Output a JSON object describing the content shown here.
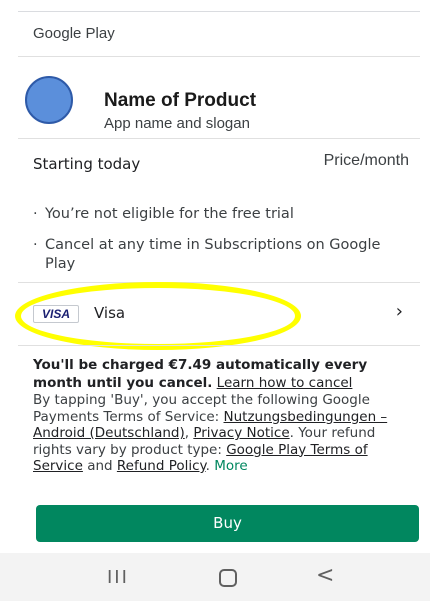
{
  "header": {
    "store_title": "Google Play"
  },
  "product": {
    "name": "Name of Product",
    "subtitle": "App name and slogan"
  },
  "pricing": {
    "start_label": "Starting today",
    "price_label": "Price/month"
  },
  "bullets": [
    "You’re not eligible for the free trial",
    "Cancel at any time in Subscriptions on Google Play"
  ],
  "payment": {
    "badge": "VISA",
    "method": "Visa",
    "chevron": "›"
  },
  "charge": {
    "bold_text": "You'll be charged €7.49 automatically every month until you cancel.",
    "link": "Learn how to cancel"
  },
  "terms": {
    "intro": "By tapping 'Buy', you accept the following Google Payments Terms of Service: ",
    "link1": "Nutzungsbedingungen – Android (Deutschland)",
    "sep1": ", ",
    "link2": "Privacy Notice",
    "mid": ". Your refund rights vary by product type: ",
    "link3": "Google Play Terms of Service",
    "and": " and ",
    "link4": "Refund Policy",
    "dot": ". ",
    "more": "More"
  },
  "buy_label": "Buy",
  "nav": {
    "recent_icon": "recent-apps-icon",
    "home_icon": "home-icon",
    "back_icon": "back-icon",
    "recent_glyph": "III",
    "back_glyph": "<"
  },
  "colors": {
    "accent": "#01875f",
    "highlight": "#ffff00",
    "avatar": "#5b8fdb"
  }
}
